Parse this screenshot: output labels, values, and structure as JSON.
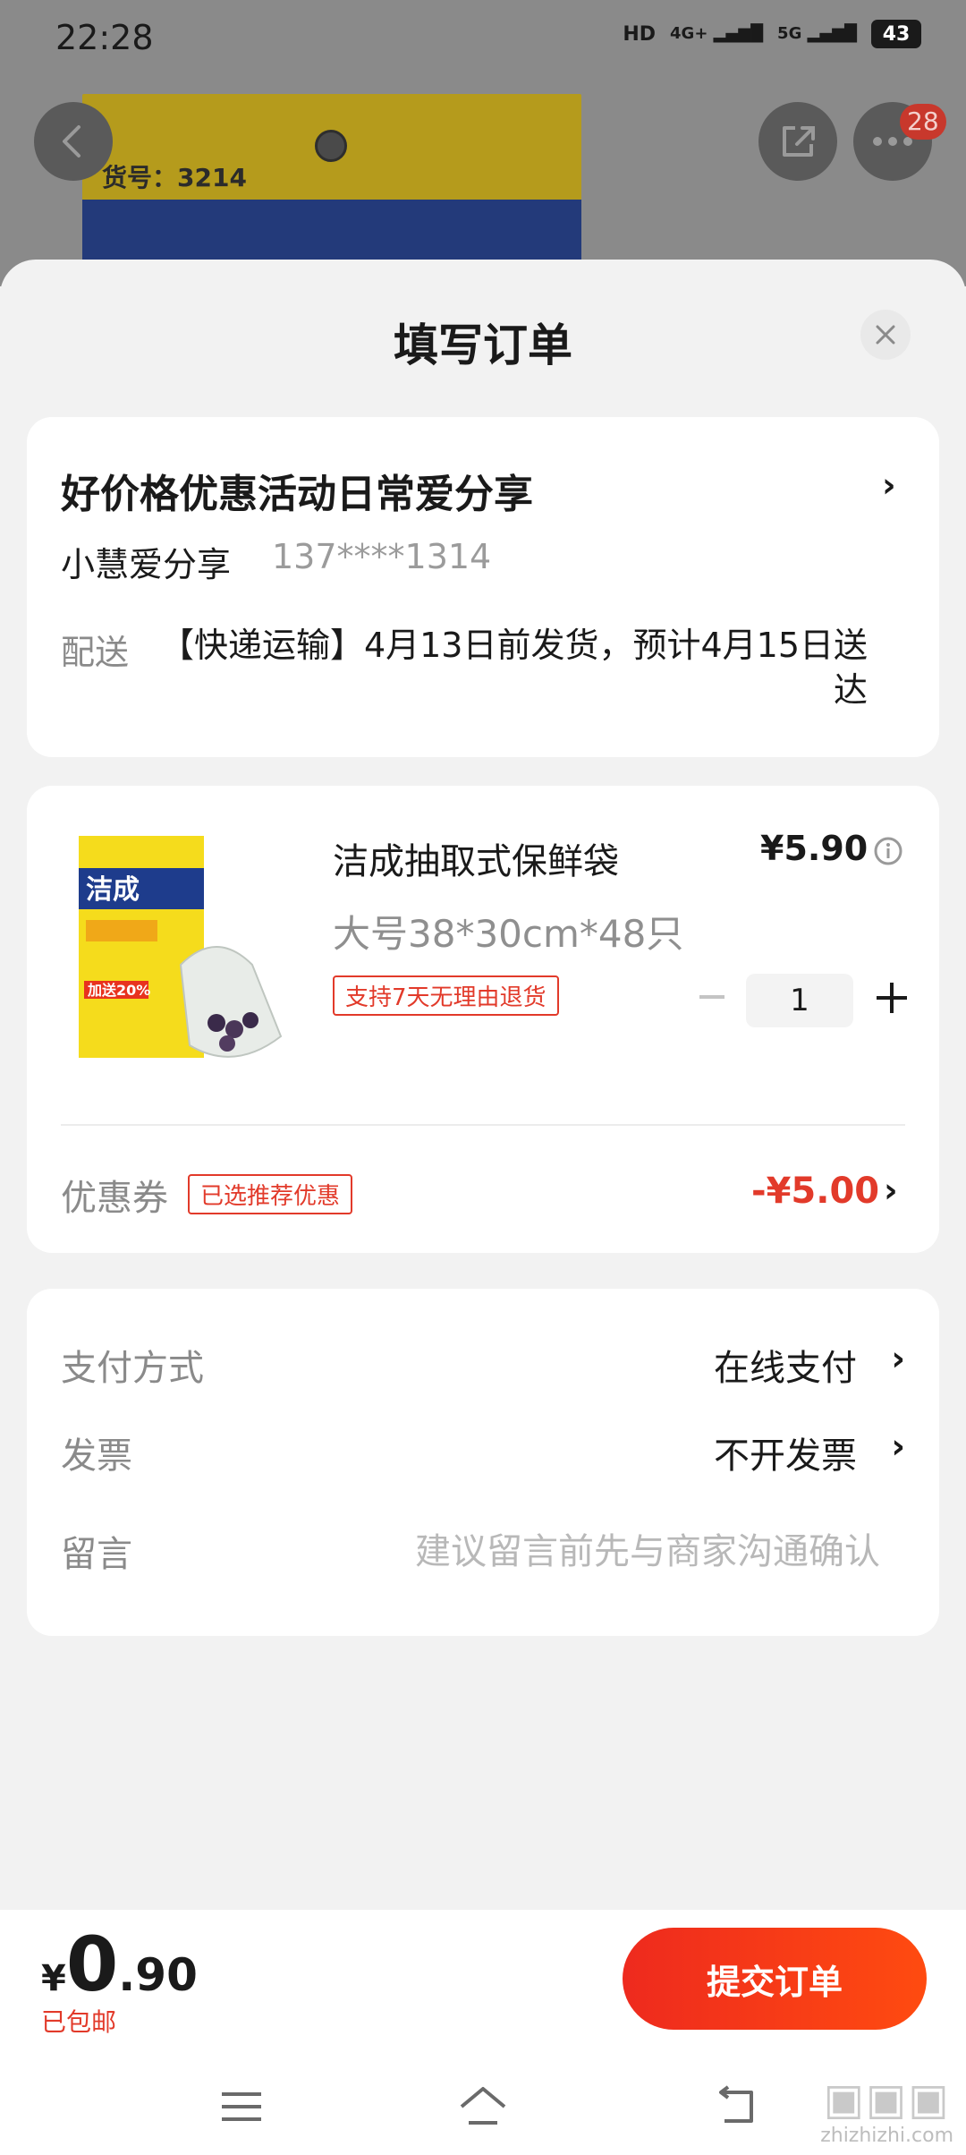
{
  "status_bar": {
    "time": "22:28",
    "network1": "HD",
    "network2": "4G+",
    "network3": "5G",
    "battery": "43"
  },
  "background": {
    "product_code": "货号：3214",
    "notification_count": "28"
  },
  "sheet": {
    "title": "填写订单"
  },
  "address": {
    "title": "好价格优惠活动日常爱分享",
    "name": "小慧爱分享",
    "phone": "137****1314",
    "shipping_label": "配送",
    "shipping_text": "【快递运输】4月13日前发货，预计4月15日送达"
  },
  "product": {
    "name": "洁成抽取式保鲜袋",
    "spec": "大号38*30cm*48只",
    "return_policy": "支持7天无理由退货",
    "price": "¥5.90",
    "quantity": "1",
    "image_brand": "洁成",
    "image_badge": "加送20%"
  },
  "coupon": {
    "label": "优惠券",
    "tag": "已选推荐优惠",
    "value": "-¥5.00"
  },
  "payment": {
    "method_label": "支付方式",
    "method_value": "在线支付",
    "invoice_label": "发票",
    "invoice_value": "不开发票",
    "memo_label": "留言",
    "memo_placeholder": "建议留言前先与商家沟通确认"
  },
  "footer": {
    "currency": "¥",
    "total_int": "0",
    "total_dec": ".90",
    "free_shipping": "已包邮",
    "submit_label": "提交订单"
  },
  "watermark": {
    "text": "zhizhizhi.com"
  },
  "colors": {
    "accent": "#e23a2a",
    "submit_start": "#ee2a1e",
    "submit_end": "#ff4b10"
  }
}
